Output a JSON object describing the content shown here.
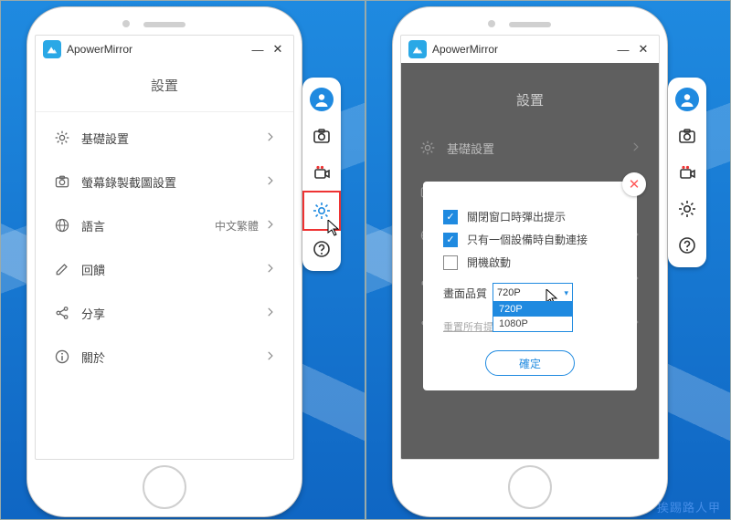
{
  "app": {
    "title": "ApowerMirror"
  },
  "settings_header": "設置",
  "rows": [
    {
      "icon": "gear",
      "label": "基礎設置",
      "extra": ""
    },
    {
      "icon": "camera",
      "label": "螢幕錄製截圖設置",
      "extra": ""
    },
    {
      "icon": "globe",
      "label": "語言",
      "extra": "中文繁體"
    },
    {
      "icon": "pencil",
      "label": "回饋",
      "extra": ""
    },
    {
      "icon": "share",
      "label": "分享",
      "extra": ""
    },
    {
      "icon": "info",
      "label": "關於",
      "extra": ""
    }
  ],
  "sidebar": {
    "items": [
      "avatar",
      "camera",
      "recorder",
      "settings",
      "help"
    ],
    "highlighted": "settings"
  },
  "modal": {
    "close_prompt": {
      "checked": true,
      "label": "關閉窗口時彈出提示"
    },
    "auto_connect": {
      "checked": true,
      "label": "只有一個設備時自動連接"
    },
    "startup": {
      "checked": false,
      "label": "開機啟動"
    },
    "quality_label": "畫面品質",
    "quality_value": "720P",
    "quality_options": [
      "720P",
      "1080P"
    ],
    "reset_label": "重置所有提示",
    "ok_label": "確定"
  },
  "watermark": "挨踢路人甲"
}
